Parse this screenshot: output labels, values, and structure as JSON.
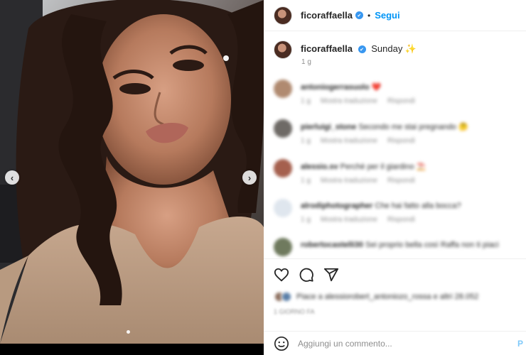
{
  "header": {
    "username": "ficoraffaella",
    "separator": "•",
    "follow_label": "Segui"
  },
  "caption": {
    "username": "ficoraffaella",
    "text": "Sunday ✨",
    "time": "1 g"
  },
  "comments": [
    {
      "username": "antoniogerrasuolo",
      "text": "❤️",
      "meta_reply": "Rispondi",
      "meta_translate": "Mostra traduzione",
      "meta_time": "1 g"
    },
    {
      "username": "pierluigi_stone",
      "text": "Secondo me stai pregnando 🤔",
      "meta_reply": "Rispondi",
      "meta_translate": "Mostra traduzione",
      "meta_time": "1 g"
    },
    {
      "username": "alessio.sv",
      "text": "Perchè per il giardino ⛱️",
      "meta_reply": "Rispondi",
      "meta_translate": "Mostra traduzione",
      "meta_time": "1 g"
    },
    {
      "username": "alrodiphotographer",
      "text": "Che hai fatto alla bocca?",
      "meta_reply": "Rispondi",
      "meta_translate": "Mostra traduzione",
      "meta_time": "1 g"
    },
    {
      "username": "robertocastelli30",
      "text": "Sei proprio bella così Raffa non ti piaci",
      "meta_reply": "",
      "meta_translate": "",
      "meta_time": ""
    }
  ],
  "likes": {
    "text": "Piace a alessiorobert_antoniozo_rossa e altri 28.052",
    "date": "1 GIORNO FA"
  },
  "add_comment": {
    "placeholder": "Aggiungi un commento...",
    "post_label": "P"
  },
  "icons": {
    "like": "heart-icon",
    "comment": "comment-icon",
    "share": "share-icon",
    "emoji": "emoji-icon",
    "verified": "verified-icon",
    "prev": "chevron-left-icon",
    "next": "chevron-right-icon"
  },
  "colors": {
    "accent": "#0095f6",
    "verified": "#3897f0",
    "muted": "#8e8e8e",
    "text": "#262626"
  },
  "carousel": {
    "total_slides": 2,
    "active_slide": 1
  }
}
